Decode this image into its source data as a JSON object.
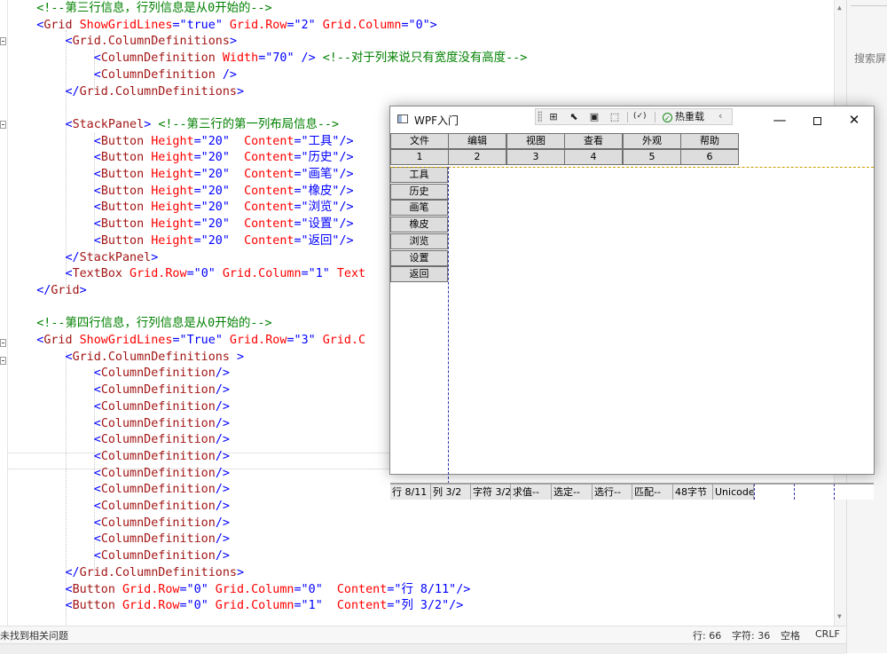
{
  "editor": {
    "lines": [
      [
        {
          "c": "c-punc",
          "t": "    "
        },
        {
          "c": "c-cmt",
          "t": "<!--第三行信息，行列信息是从0开始的-->"
        }
      ],
      [
        {
          "c": "c-punc",
          "t": "    <"
        },
        {
          "c": "c-tag",
          "t": "Grid"
        },
        {
          "c": "c-attr",
          "t": " ShowGridLines"
        },
        {
          "c": "c-punc",
          "t": "=\""
        },
        {
          "c": "c-str",
          "t": "true"
        },
        {
          "c": "c-punc",
          "t": "\""
        },
        {
          "c": "c-attr",
          "t": " Grid.Row"
        },
        {
          "c": "c-punc",
          "t": "=\""
        },
        {
          "c": "c-str",
          "t": "2"
        },
        {
          "c": "c-punc",
          "t": "\""
        },
        {
          "c": "c-attr",
          "t": " Grid.Column"
        },
        {
          "c": "c-punc",
          "t": "=\""
        },
        {
          "c": "c-str",
          "t": "0"
        },
        {
          "c": "c-punc",
          "t": "\">"
        }
      ],
      [
        {
          "c": "c-punc",
          "t": "        <"
        },
        {
          "c": "c-tag",
          "t": "Grid.ColumnDefinitions"
        },
        {
          "c": "c-punc",
          "t": ">"
        }
      ],
      [
        {
          "c": "c-punc",
          "t": "            <"
        },
        {
          "c": "c-tag",
          "t": "ColumnDefinition"
        },
        {
          "c": "c-attr",
          "t": " Width"
        },
        {
          "c": "c-punc",
          "t": "=\""
        },
        {
          "c": "c-str",
          "t": "70"
        },
        {
          "c": "c-punc",
          "t": "\" /> "
        },
        {
          "c": "c-cmt",
          "t": "<!--对于列来说只有宽度没有高度-->"
        }
      ],
      [
        {
          "c": "c-punc",
          "t": "            <"
        },
        {
          "c": "c-tag",
          "t": "ColumnDefinition"
        },
        {
          "c": "c-punc",
          "t": " />"
        }
      ],
      [
        {
          "c": "c-punc",
          "t": "        </"
        },
        {
          "c": "c-tag",
          "t": "Grid.ColumnDefinitions"
        },
        {
          "c": "c-punc",
          "t": ">"
        }
      ],
      [],
      [
        {
          "c": "c-punc",
          "t": "        <"
        },
        {
          "c": "c-tag",
          "t": "StackPanel"
        },
        {
          "c": "c-punc",
          "t": "> "
        },
        {
          "c": "c-cmt",
          "t": "<!--第三行的第一列布局信息-->"
        }
      ],
      [
        {
          "c": "c-punc",
          "t": "            <"
        },
        {
          "c": "c-tag",
          "t": "Button"
        },
        {
          "c": "c-attr",
          "t": " Height"
        },
        {
          "c": "c-punc",
          "t": "=\""
        },
        {
          "c": "c-str",
          "t": "20"
        },
        {
          "c": "c-punc",
          "t": "\"  "
        },
        {
          "c": "c-attr",
          "t": "Content"
        },
        {
          "c": "c-punc",
          "t": "=\""
        },
        {
          "c": "c-str",
          "t": "工具"
        },
        {
          "c": "c-punc",
          "t": "\"/>"
        }
      ],
      [
        {
          "c": "c-punc",
          "t": "            <"
        },
        {
          "c": "c-tag",
          "t": "Button"
        },
        {
          "c": "c-attr",
          "t": " Height"
        },
        {
          "c": "c-punc",
          "t": "=\""
        },
        {
          "c": "c-str",
          "t": "20"
        },
        {
          "c": "c-punc",
          "t": "\"  "
        },
        {
          "c": "c-attr",
          "t": "Content"
        },
        {
          "c": "c-punc",
          "t": "=\""
        },
        {
          "c": "c-str",
          "t": "历史"
        },
        {
          "c": "c-punc",
          "t": "\"/>"
        }
      ],
      [
        {
          "c": "c-punc",
          "t": "            <"
        },
        {
          "c": "c-tag",
          "t": "Button"
        },
        {
          "c": "c-attr",
          "t": " Height"
        },
        {
          "c": "c-punc",
          "t": "=\""
        },
        {
          "c": "c-str",
          "t": "20"
        },
        {
          "c": "c-punc",
          "t": "\"  "
        },
        {
          "c": "c-attr",
          "t": "Content"
        },
        {
          "c": "c-punc",
          "t": "=\""
        },
        {
          "c": "c-str",
          "t": "画笔"
        },
        {
          "c": "c-punc",
          "t": "\"/>"
        }
      ],
      [
        {
          "c": "c-punc",
          "t": "            <"
        },
        {
          "c": "c-tag",
          "t": "Button"
        },
        {
          "c": "c-attr",
          "t": " Height"
        },
        {
          "c": "c-punc",
          "t": "=\""
        },
        {
          "c": "c-str",
          "t": "20"
        },
        {
          "c": "c-punc",
          "t": "\"  "
        },
        {
          "c": "c-attr",
          "t": "Content"
        },
        {
          "c": "c-punc",
          "t": "=\""
        },
        {
          "c": "c-str",
          "t": "橡皮"
        },
        {
          "c": "c-punc",
          "t": "\"/>"
        }
      ],
      [
        {
          "c": "c-punc",
          "t": "            <"
        },
        {
          "c": "c-tag",
          "t": "Button"
        },
        {
          "c": "c-attr",
          "t": " Height"
        },
        {
          "c": "c-punc",
          "t": "=\""
        },
        {
          "c": "c-str",
          "t": "20"
        },
        {
          "c": "c-punc",
          "t": "\"  "
        },
        {
          "c": "c-attr",
          "t": "Content"
        },
        {
          "c": "c-punc",
          "t": "=\""
        },
        {
          "c": "c-str",
          "t": "浏览"
        },
        {
          "c": "c-punc",
          "t": "\"/>"
        }
      ],
      [
        {
          "c": "c-punc",
          "t": "            <"
        },
        {
          "c": "c-tag",
          "t": "Button"
        },
        {
          "c": "c-attr",
          "t": " Height"
        },
        {
          "c": "c-punc",
          "t": "=\""
        },
        {
          "c": "c-str",
          "t": "20"
        },
        {
          "c": "c-punc",
          "t": "\"  "
        },
        {
          "c": "c-attr",
          "t": "Content"
        },
        {
          "c": "c-punc",
          "t": "=\""
        },
        {
          "c": "c-str",
          "t": "设置"
        },
        {
          "c": "c-punc",
          "t": "\"/>"
        }
      ],
      [
        {
          "c": "c-punc",
          "t": "            <"
        },
        {
          "c": "c-tag",
          "t": "Button"
        },
        {
          "c": "c-attr",
          "t": " Height"
        },
        {
          "c": "c-punc",
          "t": "=\""
        },
        {
          "c": "c-str",
          "t": "20"
        },
        {
          "c": "c-punc",
          "t": "\"  "
        },
        {
          "c": "c-attr",
          "t": "Content"
        },
        {
          "c": "c-punc",
          "t": "=\""
        },
        {
          "c": "c-str",
          "t": "返回"
        },
        {
          "c": "c-punc",
          "t": "\"/>"
        }
      ],
      [
        {
          "c": "c-punc",
          "t": "        </"
        },
        {
          "c": "c-tag",
          "t": "StackPanel"
        },
        {
          "c": "c-punc",
          "t": ">"
        }
      ],
      [
        {
          "c": "c-punc",
          "t": "        <"
        },
        {
          "c": "c-tag",
          "t": "TextBox"
        },
        {
          "c": "c-attr",
          "t": " Grid.Row"
        },
        {
          "c": "c-punc",
          "t": "=\""
        },
        {
          "c": "c-str",
          "t": "0"
        },
        {
          "c": "c-punc",
          "t": "\""
        },
        {
          "c": "c-attr",
          "t": " Grid.Column"
        },
        {
          "c": "c-punc",
          "t": "=\""
        },
        {
          "c": "c-str",
          "t": "1"
        },
        {
          "c": "c-punc",
          "t": "\""
        },
        {
          "c": "c-attr",
          "t": " Text"
        }
      ],
      [
        {
          "c": "c-punc",
          "t": "    </"
        },
        {
          "c": "c-tag",
          "t": "Grid"
        },
        {
          "c": "c-punc",
          "t": ">"
        }
      ],
      [],
      [
        {
          "c": "c-punc",
          "t": "    "
        },
        {
          "c": "c-cmt",
          "t": "<!--第四行信息，行列信息是从0开始的-->"
        }
      ],
      [
        {
          "c": "c-punc",
          "t": "    <"
        },
        {
          "c": "c-tag",
          "t": "Grid"
        },
        {
          "c": "c-attr",
          "t": " ShowGridLines"
        },
        {
          "c": "c-punc",
          "t": "=\""
        },
        {
          "c": "c-str",
          "t": "True"
        },
        {
          "c": "c-punc",
          "t": "\""
        },
        {
          "c": "c-attr",
          "t": " Grid.Row"
        },
        {
          "c": "c-punc",
          "t": "=\""
        },
        {
          "c": "c-str",
          "t": "3"
        },
        {
          "c": "c-punc",
          "t": "\""
        },
        {
          "c": "c-attr",
          "t": " Grid.C"
        }
      ],
      [
        {
          "c": "c-punc",
          "t": "        <"
        },
        {
          "c": "c-tag",
          "t": "Grid.ColumnDefinitions"
        },
        {
          "c": "c-punc",
          "t": " >"
        }
      ],
      [
        {
          "c": "c-punc",
          "t": "            <"
        },
        {
          "c": "c-tag",
          "t": "ColumnDefinition"
        },
        {
          "c": "c-punc",
          "t": "/>"
        }
      ],
      [
        {
          "c": "c-punc",
          "t": "            <"
        },
        {
          "c": "c-tag",
          "t": "ColumnDefinition"
        },
        {
          "c": "c-punc",
          "t": "/>"
        }
      ],
      [
        {
          "c": "c-punc",
          "t": "            <"
        },
        {
          "c": "c-tag",
          "t": "ColumnDefinition"
        },
        {
          "c": "c-punc",
          "t": "/>"
        }
      ],
      [
        {
          "c": "c-punc",
          "t": "            <"
        },
        {
          "c": "c-tag",
          "t": "ColumnDefinition"
        },
        {
          "c": "c-punc",
          "t": "/>"
        }
      ],
      [
        {
          "c": "c-punc",
          "t": "            <"
        },
        {
          "c": "c-tag",
          "t": "ColumnDefinition"
        },
        {
          "c": "c-punc",
          "t": "/>"
        }
      ],
      [
        {
          "c": "c-punc",
          "t": "            <"
        },
        {
          "c": "c-tag",
          "t": "ColumnDefinition"
        },
        {
          "c": "c-punc",
          "t": "/>"
        }
      ],
      [
        {
          "c": "c-punc",
          "t": "            <"
        },
        {
          "c": "c-tag",
          "t": "ColumnDefinition"
        },
        {
          "c": "c-punc",
          "t": "/>"
        }
      ],
      [
        {
          "c": "c-punc",
          "t": "            <"
        },
        {
          "c": "c-tag",
          "t": "ColumnDefinition"
        },
        {
          "c": "c-punc",
          "t": "/>"
        }
      ],
      [
        {
          "c": "c-punc",
          "t": "            <"
        },
        {
          "c": "c-tag",
          "t": "ColumnDefinition"
        },
        {
          "c": "c-punc",
          "t": "/>"
        }
      ],
      [
        {
          "c": "c-punc",
          "t": "            <"
        },
        {
          "c": "c-tag",
          "t": "ColumnDefinition"
        },
        {
          "c": "c-punc",
          "t": "/>"
        }
      ],
      [
        {
          "c": "c-punc",
          "t": "            <"
        },
        {
          "c": "c-tag",
          "t": "ColumnDefinition"
        },
        {
          "c": "c-punc",
          "t": "/>"
        }
      ],
      [
        {
          "c": "c-punc",
          "t": "            <"
        },
        {
          "c": "c-tag",
          "t": "ColumnDefinition"
        },
        {
          "c": "c-punc",
          "t": "/>"
        }
      ],
      [
        {
          "c": "c-punc",
          "t": "        </"
        },
        {
          "c": "c-tag",
          "t": "Grid.ColumnDefinitions"
        },
        {
          "c": "c-punc",
          "t": ">"
        }
      ],
      [
        {
          "c": "c-punc",
          "t": "        <"
        },
        {
          "c": "c-tag",
          "t": "Button"
        },
        {
          "c": "c-attr",
          "t": " Grid.Row"
        },
        {
          "c": "c-punc",
          "t": "=\""
        },
        {
          "c": "c-str",
          "t": "0"
        },
        {
          "c": "c-punc",
          "t": "\""
        },
        {
          "c": "c-attr",
          "t": " Grid.Column"
        },
        {
          "c": "c-punc",
          "t": "=\""
        },
        {
          "c": "c-str",
          "t": "0"
        },
        {
          "c": "c-punc",
          "t": "\"  "
        },
        {
          "c": "c-attr",
          "t": "Content"
        },
        {
          "c": "c-punc",
          "t": "=\""
        },
        {
          "c": "c-str",
          "t": "行 8/11"
        },
        {
          "c": "c-punc",
          "t": "\"/>"
        }
      ],
      [
        {
          "c": "c-punc",
          "t": "        <"
        },
        {
          "c": "c-tag",
          "t": "Button"
        },
        {
          "c": "c-attr",
          "t": " Grid.Row"
        },
        {
          "c": "c-punc",
          "t": "=\""
        },
        {
          "c": "c-str",
          "t": "0"
        },
        {
          "c": "c-punc",
          "t": "\""
        },
        {
          "c": "c-attr",
          "t": " Grid.Column"
        },
        {
          "c": "c-punc",
          "t": "=\""
        },
        {
          "c": "c-str",
          "t": "1"
        },
        {
          "c": "c-punc",
          "t": "\"  "
        },
        {
          "c": "c-attr",
          "t": "Content"
        },
        {
          "c": "c-punc",
          "t": "=\""
        },
        {
          "c": "c-str",
          "t": "列 3/2"
        },
        {
          "c": "c-punc",
          "t": "\"/>"
        }
      ]
    ]
  },
  "side_panel": {
    "search_placeholder": "搜索屏"
  },
  "status_bar": {
    "issues": "未找到相关问题",
    "line": "行: 66",
    "chars": "字符: 36",
    "indent": "空格",
    "eol": "CRLF"
  },
  "wpf_window": {
    "title": "WPF入门",
    "hot_reload": "热重载",
    "toolbar_icons": [
      "select-element-icon",
      "pointer-icon",
      "layout-adorner-icon",
      "track-focus-icon",
      "binding-icon"
    ],
    "menu": [
      "文件",
      "编辑",
      "视图",
      "查看",
      "外观",
      "帮助"
    ],
    "numbers": [
      "1",
      "2",
      "3",
      "4",
      "5",
      "6"
    ],
    "left_buttons": [
      "工具",
      "历史",
      "画笔",
      "橡皮",
      "浏览",
      "设置",
      "返回"
    ],
    "status_cells": [
      "行 8/11",
      "列 3/2",
      "字符 3/2",
      "求值--",
      "选定--",
      "选行--",
      "匹配--",
      "48字节",
      "Unicode"
    ],
    "grid_line_color": "#3333aa",
    "row_line_color": "#c8a000"
  }
}
